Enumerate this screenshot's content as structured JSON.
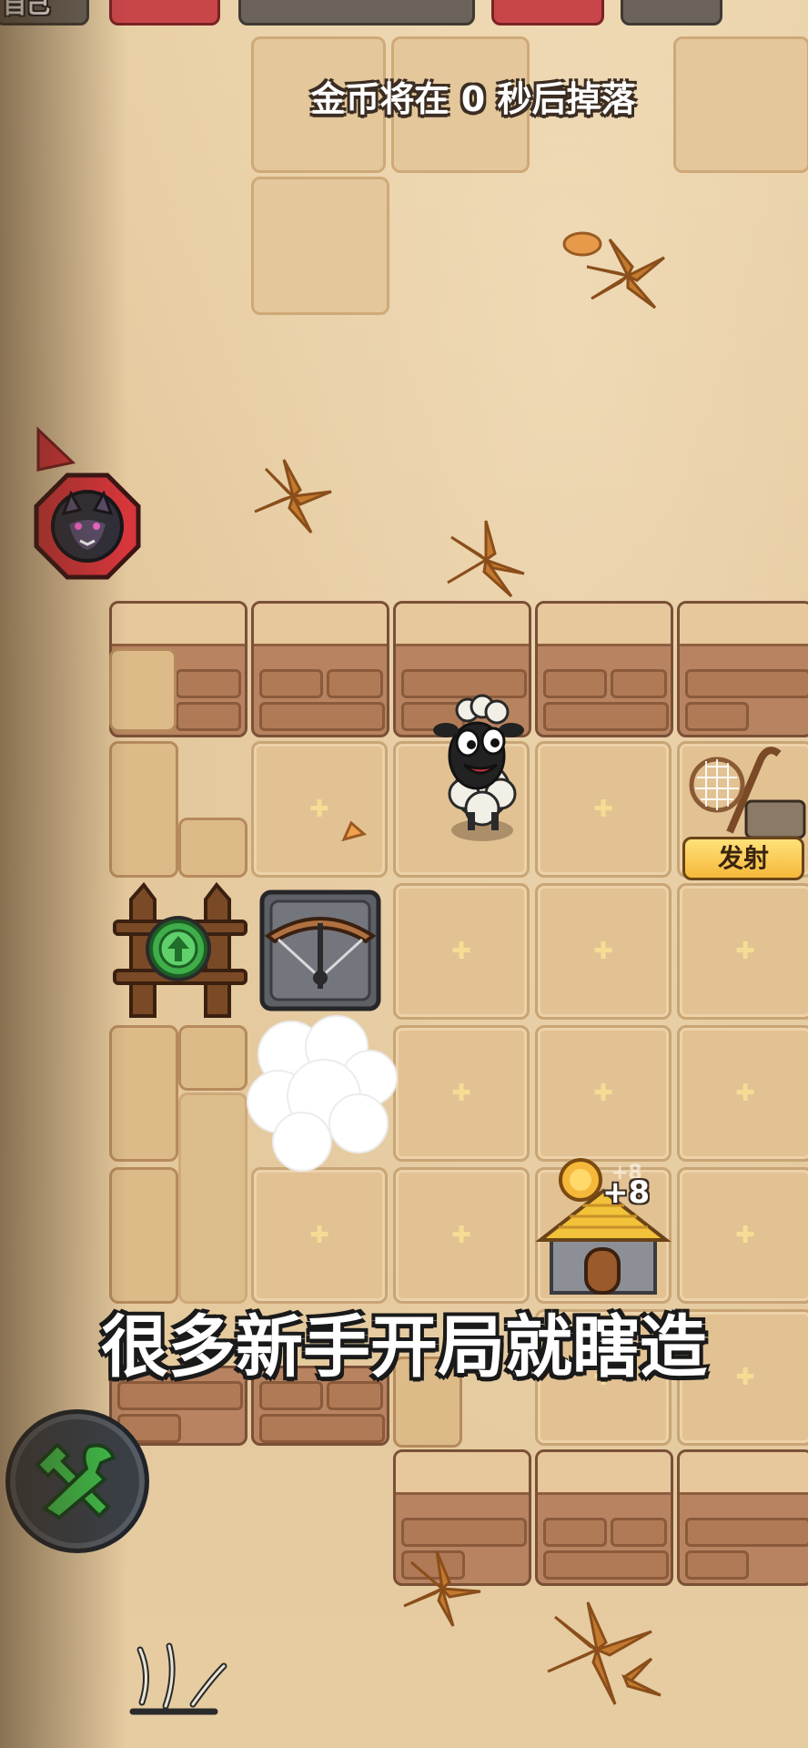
{
  "hud": {
    "corner_label": "自己",
    "coin_drop_prefix": "金币将在",
    "coin_drop_seconds": "0",
    "coin_drop_suffix": "秒后掉落"
  },
  "board": {
    "launch_button": "发射",
    "income_popup": "+8",
    "income_popup_ghost": "+8"
  },
  "subtitle": "很多新手开局就瞎造",
  "icons": [
    "wolf-enemy-icon",
    "upgrade-arrow-icon",
    "crossbow-trap-icon",
    "slingshot-net-icon",
    "gold-mine-house-icon",
    "build-hammer-wrench-icon",
    "sheep-player-icon",
    "offscreen-arrow-icon"
  ],
  "colors": {
    "accent_green": "#3fae4a",
    "alert_red": "#d7363b",
    "button_gold": "#f5b83a"
  }
}
